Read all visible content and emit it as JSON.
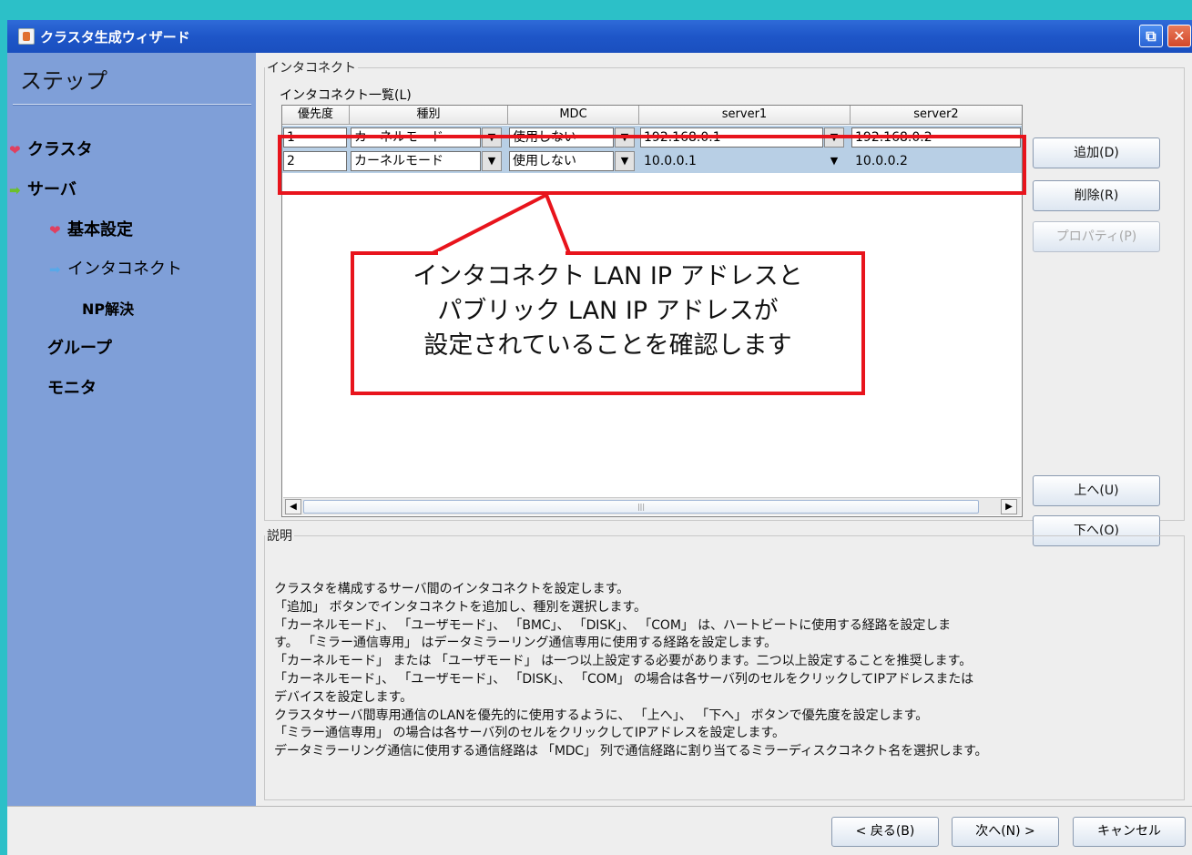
{
  "window": {
    "title": "クラスタ生成ウィザード",
    "restore_icon": "restore-icon",
    "close_icon": "close-icon"
  },
  "sidebar": {
    "title": "ステップ",
    "steps": [
      {
        "label": "クラスタ",
        "mark": "check"
      },
      {
        "label": "サーバ",
        "mark": "arrow"
      },
      {
        "label": "基本設定",
        "mark": "check"
      },
      {
        "label": "インタコネクト",
        "mark": "arrow-current"
      },
      {
        "label": "NP解決",
        "mark": ""
      },
      {
        "label": "グループ",
        "mark": ""
      },
      {
        "label": "モニタ",
        "mark": ""
      }
    ]
  },
  "interconnect": {
    "group_label": "インタコネクト",
    "list_label": "インタコネクト一覧(L)",
    "columns": [
      "優先度",
      "種別",
      "MDC",
      "server1",
      "server2"
    ],
    "rows": [
      {
        "priority": "1",
        "type": "カーネルモード",
        "mdc": "使用しない",
        "server1": "192.168.0.1",
        "server2": "192.168.0.2"
      },
      {
        "priority": "2",
        "type": "カーネルモード",
        "mdc": "使用しない",
        "server1": "10.0.0.1",
        "server2": "10.0.0.2"
      }
    ],
    "buttons": {
      "add": "追加(D)",
      "delete": "削除(R)",
      "properties": "プロパティ(P)",
      "up": "上へ(U)",
      "down": "下へ(O)"
    }
  },
  "callout": {
    "lines": [
      "インタコネクト LAN IP アドレスと",
      "パブリック LAN IP アドレスが",
      "設定されていることを確認します"
    ],
    "color": "#e8141c"
  },
  "description": {
    "group_label": "説明",
    "lines": [
      "クラスタを構成するサーバ間のインタコネクトを設定します。",
      "「追加」 ボタンでインタコネクトを追加し、種別を選択します。",
      "「カーネルモード」、 「ユーザモード」、 「BMC」、 「DISK」、 「COM」 は、ハートビートに使用する経路を設定しま",
      "す。 「ミラー通信専用」 はデータミラーリング通信専用に使用する経路を設定します。",
      "「カーネルモード」 または 「ユーザモード」 は一つ以上設定する必要があります。二つ以上設定することを推奨します。",
      "「カーネルモード」、 「ユーザモード」、 「DISK」、 「COM」 の場合は各サーバ列のセルをクリックしてIPアドレスまたは",
      "デバイスを設定します。",
      "クラスタサーバ間専用通信のLANを優先的に使用するように、 「上へ」、 「下へ」 ボタンで優先度を設定します。",
      "「ミラー通信専用」 の場合は各サーバ列のセルをクリックしてIPアドレスを設定します。",
      "データミラーリング通信に使用する通信経路は 「MDC」 列で通信経路に割り当てるミラーディスクコネクト名を選択します。"
    ]
  },
  "footer": {
    "back": "< 戻る(B)",
    "next": "次へ(N) >",
    "cancel": "キャンセル"
  }
}
